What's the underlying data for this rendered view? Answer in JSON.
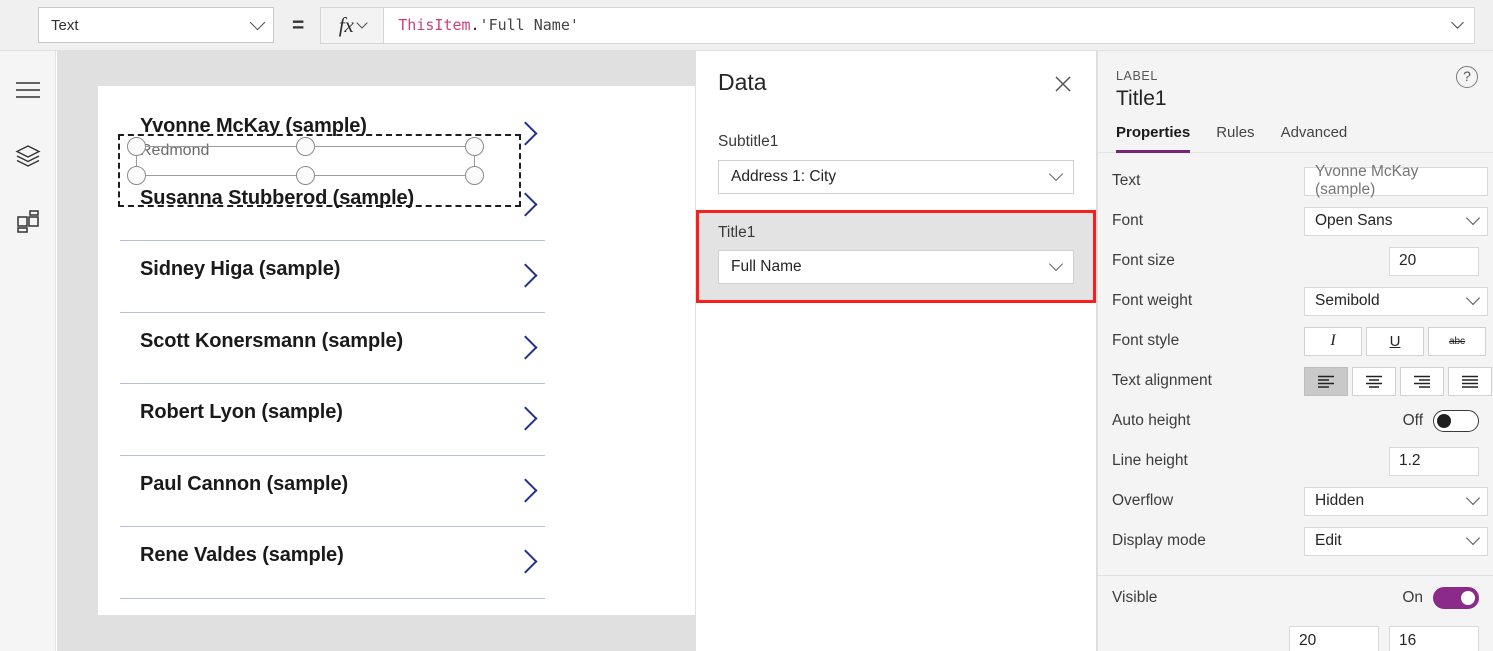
{
  "formula_bar": {
    "property_selector": {
      "value": "Text",
      "icon": "chevron-down-icon"
    },
    "equals": "=",
    "fx_label": "fx",
    "formula": {
      "ref": "ThisItem",
      "dot": ".",
      "field": "'Full Name'",
      "full": "ThisItem.'Full Name'"
    }
  },
  "left_rail": {
    "items": [
      {
        "icon": "hamburger-menu-icon",
        "name": "menu"
      },
      {
        "icon": "layers-icon",
        "name": "tree-view"
      },
      {
        "icon": "grid-insert-icon",
        "name": "insert"
      }
    ]
  },
  "canvas": {
    "gallery": {
      "items": [
        {
          "title": "Yvonne McKay (sample)",
          "subtitle": "Redmond",
          "selected": true
        },
        {
          "title": "Susanna Stubberod (sample)",
          "subtitle": "",
          "selected": false
        },
        {
          "title": "Sidney Higa (sample)",
          "subtitle": "",
          "selected": false
        },
        {
          "title": "Scott Konersmann (sample)",
          "subtitle": "",
          "selected": false
        },
        {
          "title": "Robert Lyon (sample)",
          "subtitle": "",
          "selected": false
        },
        {
          "title": "Paul Cannon (sample)",
          "subtitle": "",
          "selected": false
        },
        {
          "title": "Rene Valdes (sample)",
          "subtitle": "",
          "selected": false
        }
      ],
      "chevron_icon": "chevron-right-icon",
      "chevron_color": "#22308f"
    }
  },
  "data_panel": {
    "title": "Data",
    "close_icon": "close-icon",
    "fields": [
      {
        "label": "Subtitle1",
        "value": "Address 1: City",
        "highlighted": false
      },
      {
        "label": "Title1",
        "value": "Full Name",
        "highlighted": true
      }
    ],
    "highlight_color": "#fc1d1d"
  },
  "properties_panel": {
    "kicker": "LABEL",
    "name": "Title1",
    "help_icon": "help-circle-icon",
    "accent_color": "#742774",
    "tabs": [
      {
        "label": "Properties",
        "active": true
      },
      {
        "label": "Rules",
        "active": false
      },
      {
        "label": "Advanced",
        "active": false
      }
    ],
    "rows": {
      "text": {
        "label": "Text",
        "value": "Yvonne McKay (sample)"
      },
      "font": {
        "label": "Font",
        "value": "Open Sans"
      },
      "font_size": {
        "label": "Font size",
        "value": "20"
      },
      "font_weight": {
        "label": "Font weight",
        "value": "Semibold"
      },
      "font_style": {
        "label": "Font style",
        "buttons": [
          {
            "name": "italic",
            "glyph": "I"
          },
          {
            "name": "underline",
            "glyph": "U"
          },
          {
            "name": "strikethrough",
            "glyph": "abc"
          }
        ]
      },
      "text_alignment": {
        "label": "Text alignment",
        "buttons": [
          {
            "name": "align-left",
            "selected": true
          },
          {
            "name": "align-center",
            "selected": false
          },
          {
            "name": "align-right",
            "selected": false
          },
          {
            "name": "align-justify",
            "selected": false
          }
        ]
      },
      "auto_height": {
        "label": "Auto height",
        "state": "Off",
        "on": false
      },
      "line_height": {
        "label": "Line height",
        "value": "1.2"
      },
      "overflow": {
        "label": "Overflow",
        "value": "Hidden"
      },
      "display_mode": {
        "label": "Display mode",
        "value": "Edit"
      },
      "visible": {
        "label": "Visible",
        "state": "On",
        "on": true
      },
      "position": {
        "x": "20",
        "y": "16"
      }
    }
  }
}
